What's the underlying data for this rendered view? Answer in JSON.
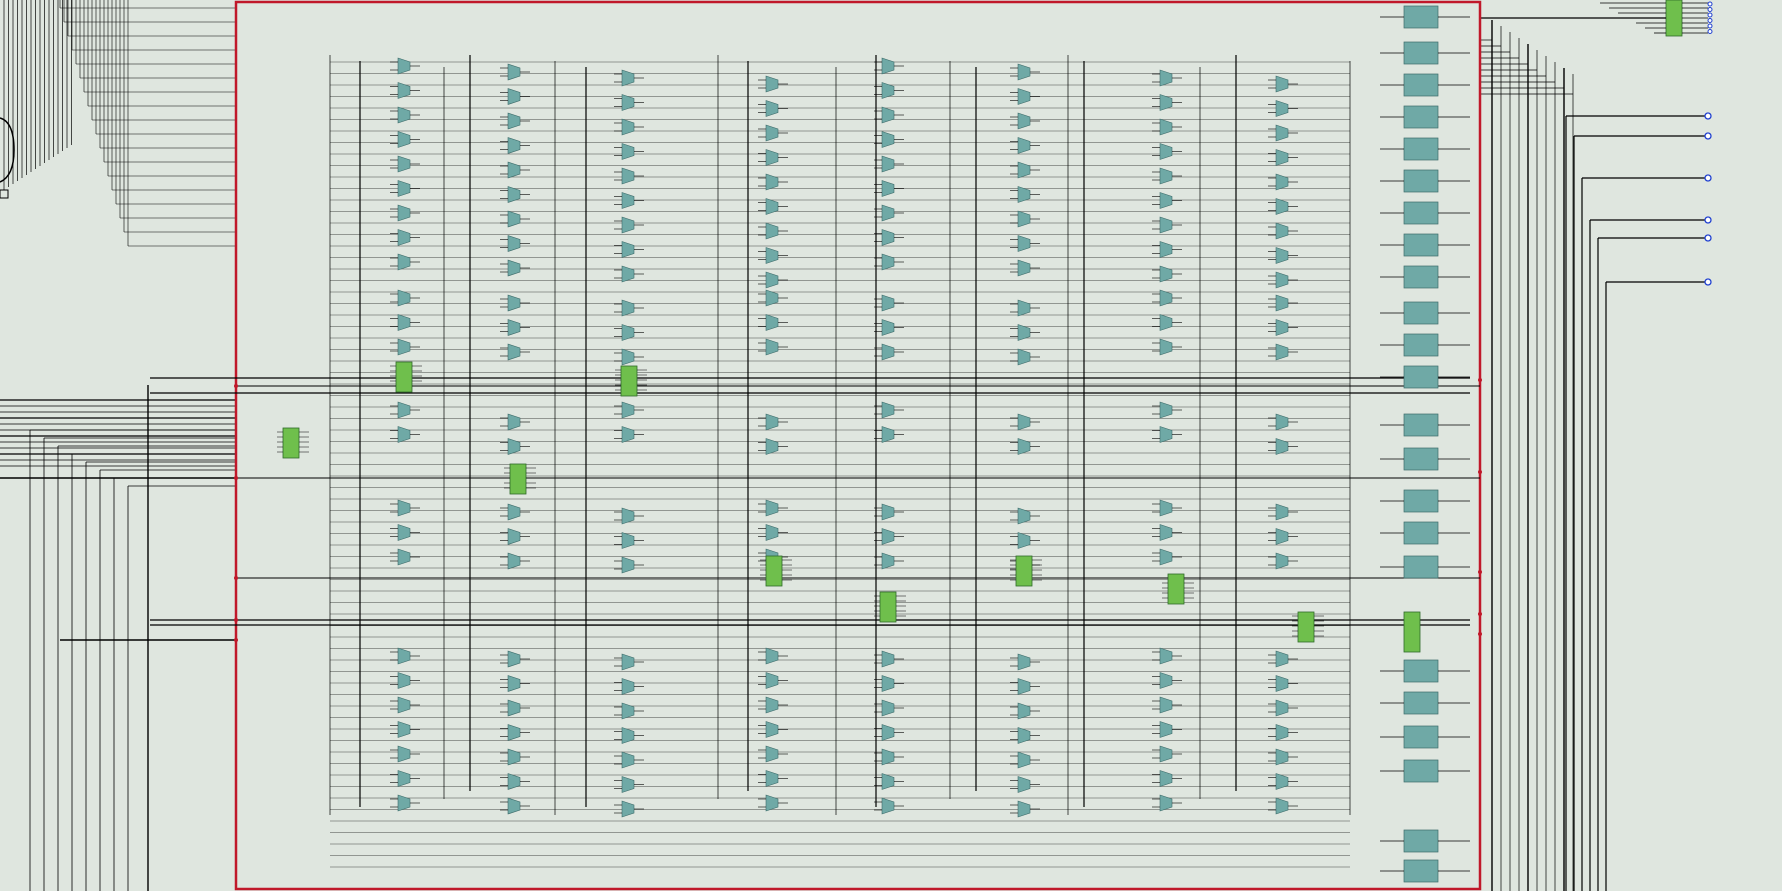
{
  "view": {
    "background": "#dfe6df",
    "module_border_color": "#c0182a",
    "wire_color": "#000000",
    "mux_fill": "#6fa9a6",
    "mux_stroke": "#3d6c6a",
    "register_fill": "#6fa9a6",
    "controller_fill": "#6fbf4c",
    "port_color": "#1f3fd0"
  },
  "module": {
    "name": "",
    "mux_columns": 10,
    "output_register_column": true
  },
  "controllers": [
    {
      "id": "ctrl-left",
      "icon": "block-icon"
    },
    {
      "id": "ctrl-1",
      "icon": "block-icon"
    },
    {
      "id": "ctrl-2",
      "icon": "block-icon"
    },
    {
      "id": "ctrl-3",
      "icon": "block-icon"
    },
    {
      "id": "ctrl-4",
      "icon": "block-icon"
    },
    {
      "id": "ctrl-5",
      "icon": "block-icon"
    },
    {
      "id": "ctrl-6",
      "icon": "block-icon"
    },
    {
      "id": "ctrl-7",
      "icon": "block-icon"
    },
    {
      "id": "ctrl-8",
      "icon": "block-icon"
    },
    {
      "id": "ctrl-out",
      "icon": "block-icon"
    }
  ],
  "output_ports": [
    {
      "icon": "output-port-icon"
    },
    {
      "icon": "output-port-icon"
    },
    {
      "icon": "output-port-icon"
    },
    {
      "icon": "output-port-icon"
    },
    {
      "icon": "output-port-icon"
    },
    {
      "icon": "output-port-icon"
    }
  ]
}
